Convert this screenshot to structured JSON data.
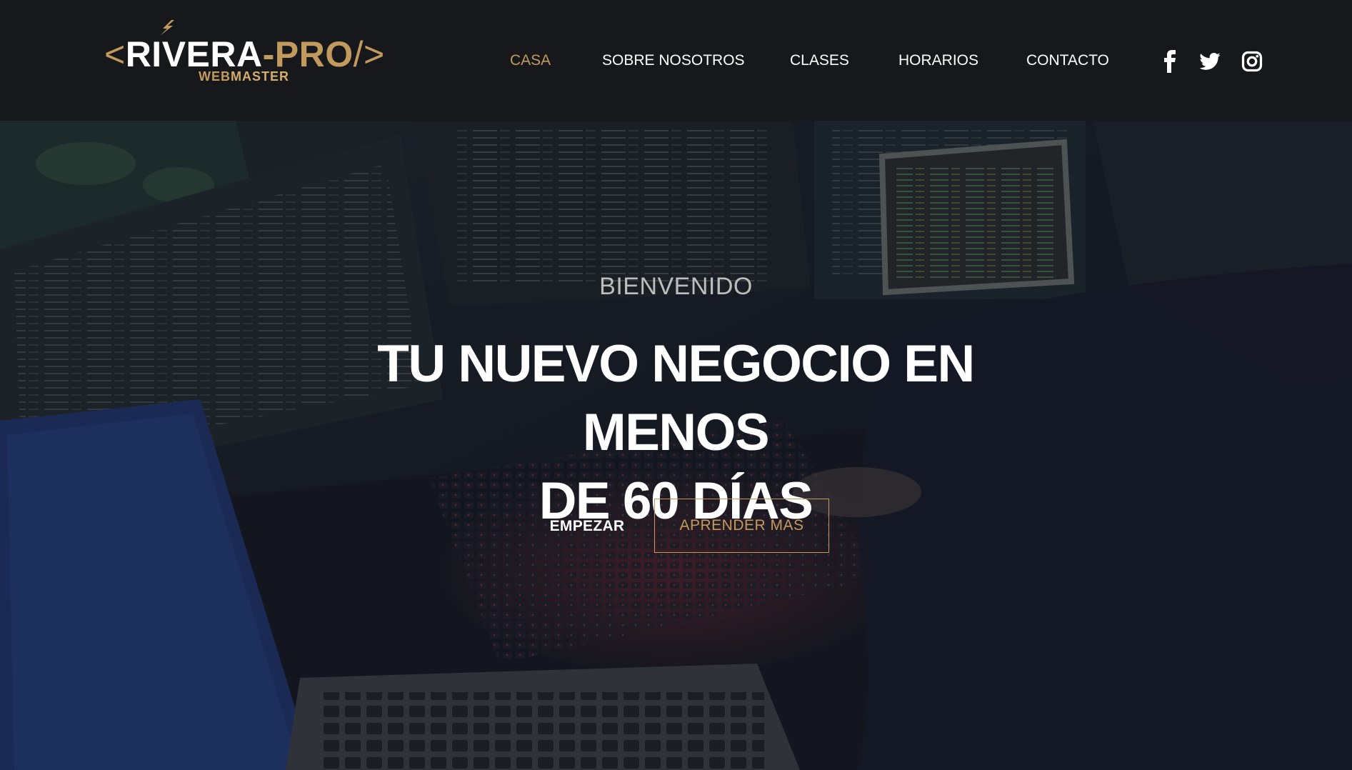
{
  "brand": {
    "logo_bracket_open": "<",
    "logo_name_a": "RIVERA",
    "logo_name_b": "-PRO",
    "logo_bracket_close": "/>",
    "logo_sub_a": "WEB",
    "logo_sub_b": "MASTER"
  },
  "nav": {
    "items": [
      {
        "label": "CASA",
        "active": true
      },
      {
        "label": "SOBRE NOSOTROS",
        "active": false
      },
      {
        "label": "CLASES",
        "active": false
      },
      {
        "label": "HORARIOS",
        "active": false
      },
      {
        "label": "CONTACTO",
        "active": false
      }
    ]
  },
  "social": {
    "icons": [
      "facebook-icon",
      "twitter-icon",
      "instagram-icon"
    ]
  },
  "hero": {
    "kicker": "BIENVENIDO",
    "headline_line1": "TU NUEVO NEGOCIO EN MENOS",
    "headline_line2": "DE 60 DÍAS",
    "primary_button": "EMPEZAR",
    "secondary_button": "APRENDER MAS"
  },
  "colors": {
    "accent": "#c39a5e",
    "header_bg": "#16181b",
    "text": "#ffffff"
  }
}
